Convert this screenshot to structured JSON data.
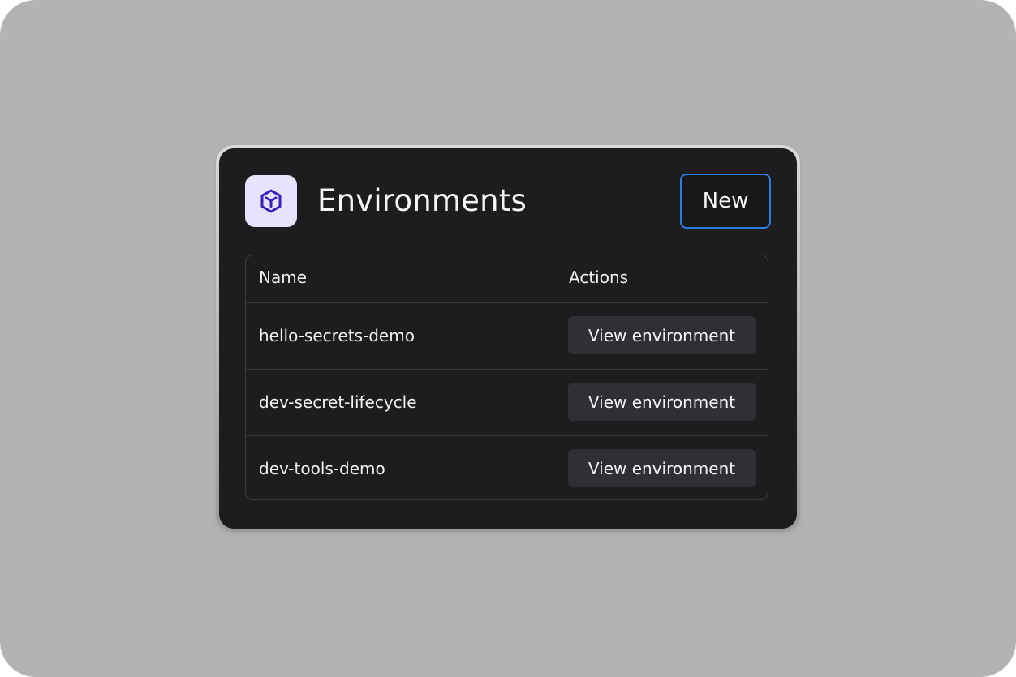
{
  "header": {
    "title": "Environments",
    "new_button_label": "New",
    "icon": "cube-icon"
  },
  "table": {
    "columns": [
      "Name",
      "Actions"
    ],
    "rows": [
      {
        "name": "hello-secrets-demo",
        "action_label": "View environment"
      },
      {
        "name": "dev-secret-lifecycle",
        "action_label": "View environment"
      },
      {
        "name": "dev-tools-demo",
        "action_label": "View environment"
      }
    ]
  },
  "colors": {
    "background": "#b3b3b5",
    "card": "#1d1d20",
    "accent_border": "#2a7de1",
    "icon_bg": "#e6e4fc",
    "icon_fg": "#3b1fb8",
    "button_bg": "#303034"
  }
}
